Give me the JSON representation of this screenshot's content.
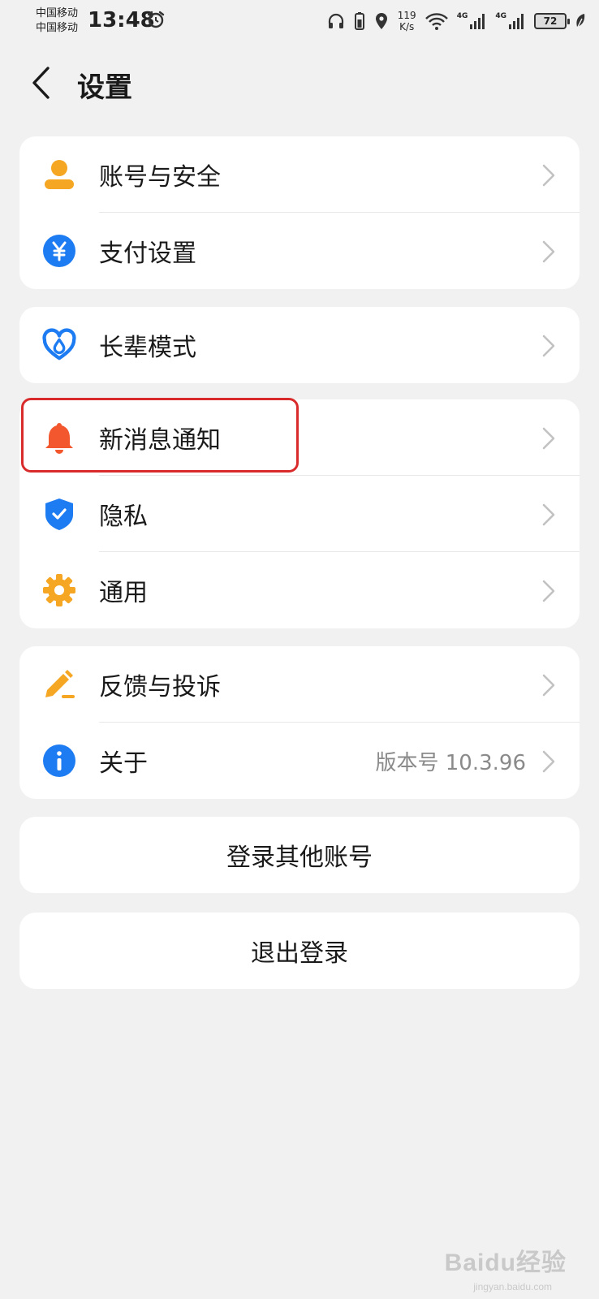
{
  "status_bar": {
    "carrier_1": "中国移动",
    "carrier_2": "中国移动",
    "time": "13:48",
    "speed_value": "119",
    "speed_unit": "K/s",
    "network_1": "4G",
    "network_2": "4G",
    "battery": "72"
  },
  "header": {
    "title": "设置"
  },
  "groups": [
    {
      "items": [
        {
          "label": "账号与安全",
          "icon": "user-icon"
        },
        {
          "label": "支付设置",
          "icon": "yen-icon"
        }
      ]
    },
    {
      "items": [
        {
          "label": "长辈模式",
          "icon": "heart-icon"
        }
      ]
    },
    {
      "items": [
        {
          "label": "新消息通知",
          "icon": "bell-icon"
        },
        {
          "label": "隐私",
          "icon": "shield-icon"
        },
        {
          "label": "通用",
          "icon": "gear-icon"
        }
      ]
    },
    {
      "items": [
        {
          "label": "反馈与投诉",
          "icon": "pencil-icon"
        },
        {
          "label": "关于",
          "icon": "info-icon",
          "value": "版本号 10.3.96"
        }
      ]
    }
  ],
  "actions": {
    "switch_account": "登录其他账号",
    "logout": "退出登录"
  },
  "watermark": {
    "brand": "Baidu经验",
    "url": "jingyan.baidu.com"
  },
  "colors": {
    "background": "#f1f1f1",
    "card": "#ffffff",
    "highlight": "#d92b2b",
    "orange": "#f5a623",
    "blue": "#1e7cf2",
    "red_orange": "#f2572d"
  }
}
